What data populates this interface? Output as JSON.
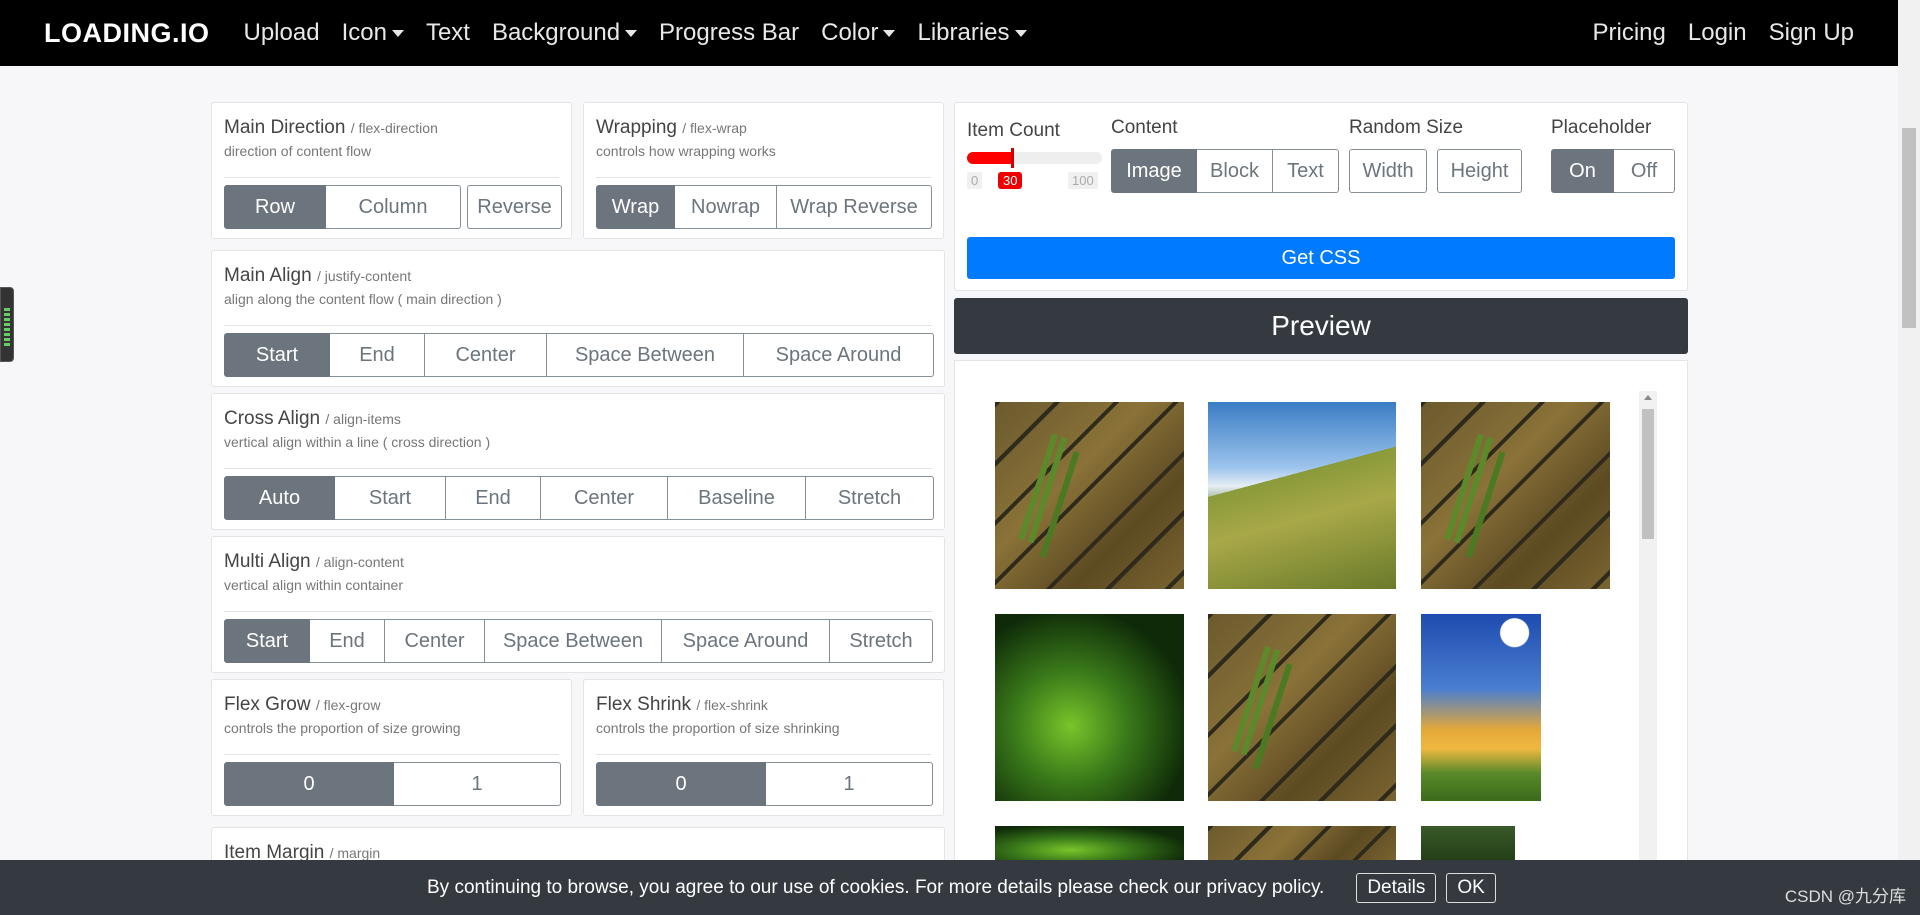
{
  "navbar": {
    "brand": "LOADING.IO",
    "items": [
      "Upload",
      "Icon",
      "Text",
      "Background",
      "Progress Bar",
      "Color",
      "Libraries"
    ],
    "right_items": [
      "Pricing",
      "Login",
      "Sign Up"
    ]
  },
  "panels": {
    "main_direction": {
      "title": "Main Direction",
      "prop": "/ flex-direction",
      "desc": "direction of content flow",
      "options": [
        "Row",
        "Column"
      ],
      "extra": "Reverse",
      "selected": "Row"
    },
    "wrapping": {
      "title": "Wrapping",
      "prop": "/ flex-wrap",
      "desc": "controls how wrapping works",
      "options": [
        "Wrap",
        "Nowrap",
        "Wrap Reverse"
      ],
      "selected": "Wrap"
    },
    "main_align": {
      "title": "Main Align",
      "prop": "/ justify-content",
      "desc": "align along the content flow ( main direction )",
      "options": [
        "Start",
        "End",
        "Center",
        "Space Between",
        "Space Around"
      ],
      "selected": "Start"
    },
    "cross_align": {
      "title": "Cross Align",
      "prop": "/ align-items",
      "desc": "vertical align within a line ( cross direction )",
      "options": [
        "Auto",
        "Start",
        "End",
        "Center",
        "Baseline",
        "Stretch"
      ],
      "selected": "Auto"
    },
    "multi_align": {
      "title": "Multi Align",
      "prop": "/ align-content",
      "desc": "vertical align within container",
      "options": [
        "Start",
        "End",
        "Center",
        "Space Between",
        "Space Around",
        "Stretch"
      ],
      "selected": "Start"
    },
    "flex_grow": {
      "title": "Flex Grow",
      "prop": "/ flex-grow",
      "desc": "controls the proportion of size growing",
      "options": [
        "0",
        "1"
      ],
      "selected": "0"
    },
    "flex_shrink": {
      "title": "Flex Shrink",
      "prop": "/ flex-shrink",
      "desc": "controls the proportion of size shrinking",
      "options": [
        "0",
        "1"
      ],
      "selected": "0"
    },
    "item_margin": {
      "title": "Item Margin",
      "prop": "/ margin"
    }
  },
  "config": {
    "item_count": {
      "label": "Item Count",
      "min": "0",
      "max": "100",
      "value": "30",
      "fraction": 0.3
    },
    "content": {
      "label": "Content",
      "options": [
        "Image",
        "Block",
        "Text"
      ],
      "selected": "Image"
    },
    "random_size": {
      "label": "Random Size",
      "options": [
        "Width",
        "Height"
      ]
    },
    "placeholder": {
      "label": "Placeholder",
      "options": [
        "On",
        "Off"
      ],
      "selected": "On"
    },
    "get_css": "Get CSS"
  },
  "preview": {
    "title": "Preview"
  },
  "cookie": {
    "text": "By continuing to browse, you agree to our use of cookies. For more details please check our privacy policy.",
    "details": "Details",
    "ok": "OK"
  },
  "watermark": "CSDN @九分库"
}
